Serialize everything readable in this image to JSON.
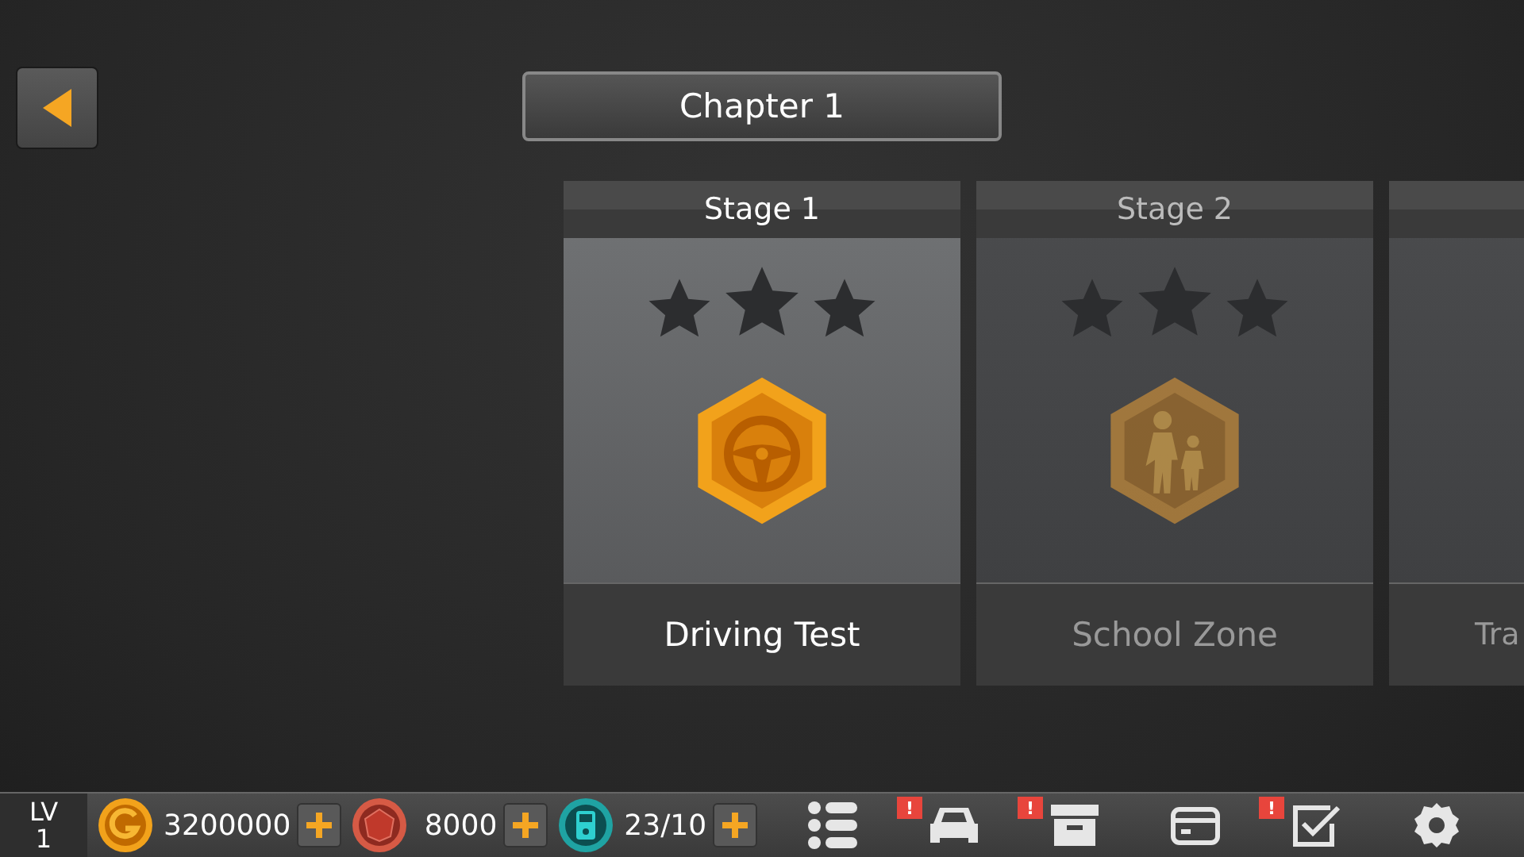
{
  "chapter": {
    "title": "Chapter 1"
  },
  "stages": [
    {
      "kind": "wheel",
      "clipped": false,
      "label": "Stage 1",
      "name": "Driving Test",
      "stars": 0,
      "locked": false
    },
    {
      "kind": "people",
      "clipped": false,
      "label": "Stage 2",
      "name": "School Zone",
      "stars": 0,
      "locked": true
    },
    {
      "kind": "unknown",
      "clipped": true,
      "name": "Tra",
      "locked": true
    }
  ],
  "status_bar": {
    "level_label": "LV",
    "level": "1",
    "currencies": [
      {
        "kind": "gold",
        "amount": "3200000"
      },
      {
        "kind": "gem",
        "amount": "8000"
      },
      {
        "kind": "fuel",
        "amount": "23/10"
      }
    ],
    "nav": [
      {
        "kind": "list",
        "badge": false
      },
      {
        "kind": "car",
        "badge": true
      },
      {
        "kind": "box",
        "badge": true
      },
      {
        "kind": "card",
        "badge": false
      },
      {
        "kind": "check",
        "badge": true
      },
      {
        "kind": "gear",
        "badge": false
      }
    ],
    "badge_text": "!"
  }
}
